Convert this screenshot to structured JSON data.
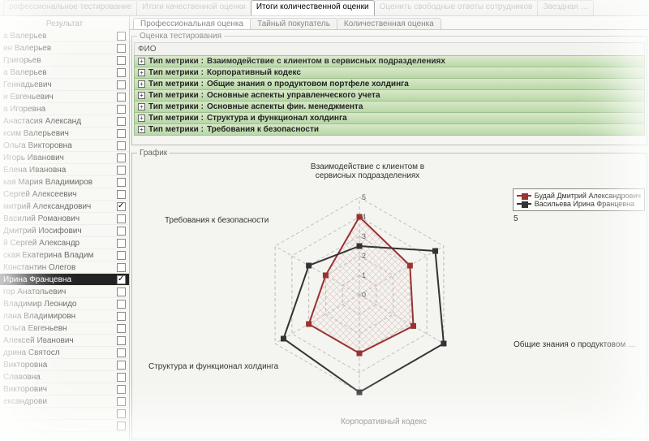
{
  "mainTabs": [
    {
      "label": "рофессиональное тестирование",
      "active": false
    },
    {
      "label": "Итоги качественной оценки",
      "active": false
    },
    {
      "label": "Итоги количественной оценки",
      "active": true
    },
    {
      "label": "Оценить свободные ответы сотрудников",
      "active": false
    },
    {
      "label": "Звездная …",
      "active": false
    }
  ],
  "sidebar": {
    "header": "Результат",
    "items": [
      {
        "label": "а Валерьев",
        "checked": false
      },
      {
        "label": "ин Валерьев",
        "checked": false
      },
      {
        "label": "Григорьев",
        "checked": false
      },
      {
        "label": "а Валерьев",
        "checked": false
      },
      {
        "label": "Геннадьевич",
        "checked": false
      },
      {
        "label": "и Евгеньевич",
        "checked": false
      },
      {
        "label": "а Игоревна",
        "checked": false
      },
      {
        "label": "Анастасия Александ",
        "checked": false
      },
      {
        "label": "ксим Валерьевич",
        "checked": false
      },
      {
        "label": "Ольга Викторовна",
        "checked": false
      },
      {
        "label": "Игорь Иванович",
        "checked": false
      },
      {
        "label": "Елена Ивановна",
        "checked": false
      },
      {
        "label": "кая Мария Владимиров",
        "checked": false
      },
      {
        "label": "Сергей Алексеевич",
        "checked": false
      },
      {
        "label": "митрий Александрович",
        "checked": true
      },
      {
        "label": "Василий Романович",
        "checked": false
      },
      {
        "label": "Дмитрий Иосифович",
        "checked": false
      },
      {
        "label": "й Сергей Александр",
        "checked": false
      },
      {
        "label": "ская Екатерина Владим",
        "checked": false
      },
      {
        "label": "Константин Олегов",
        "checked": false
      },
      {
        "label": "Ирина Францевна",
        "checked": true,
        "selected": true
      },
      {
        "label": "гор Анатольевич",
        "checked": false
      },
      {
        "label": "Владимир Леонидо",
        "checked": false
      },
      {
        "label": "лана Владимировн",
        "checked": false
      },
      {
        "label": "Ольга Евгеньевн",
        "checked": false
      },
      {
        "label": "Алексей Иванович",
        "checked": false
      },
      {
        "label": "дрина Святосл",
        "checked": false
      },
      {
        "label": "Викторовна",
        "checked": false
      },
      {
        "label": "Славовна",
        "checked": false
      },
      {
        "label": "Викторович",
        "checked": false
      },
      {
        "label": "ександрови",
        "checked": false
      },
      {
        "label": "",
        "checked": false
      },
      {
        "label": "",
        "checked": false
      }
    ]
  },
  "subTabs": [
    {
      "label": "Профессиональная оценка",
      "active": true
    },
    {
      "label": "Тайный покупатель",
      "active": false
    },
    {
      "label": "Количественная оценка",
      "active": false
    }
  ],
  "testingLegend": "Оценка тестирования",
  "gridHeader": "ФИО",
  "metricPrefix": "Тип метрики : ",
  "metrics": [
    "Взаимодействие с клиентом в сервисных подразделениях",
    "Корпоративный кодекс",
    "Общие знания о продуктовом портфеле холдинга",
    "Основные аспекты управленческого учета",
    "Основные аспекты фин. менеджмента",
    "Структура и функционал холдинга",
    "Требования к безопасности"
  ],
  "chartLegend": "График",
  "legendEntries": [
    {
      "label": "Будай Дмитрий Александрович",
      "color": "#993333"
    },
    {
      "label": "Васильева Ирина Францевна",
      "color": "#333333"
    }
  ],
  "chart_data": {
    "type": "radar",
    "axisMax": 5,
    "categories": [
      "Взаимодействие с клиентом в сервисных подразделениях",
      "5",
      "Общие знания о продуктовом …",
      "Корпоративный кодекс",
      "Структура и функционал холдинга",
      "Требования к безопасности"
    ],
    "ticks": [
      0,
      1,
      2,
      3,
      4,
      5
    ],
    "series": [
      {
        "name": "Будай Дмитрий Александрович",
        "color": "#993333",
        "values": [
          4.0,
          3.0,
          3.2,
          3.0,
          3.0,
          2.0
        ]
      },
      {
        "name": "Васильева Ирина Францевна",
        "color": "#333333",
        "values": [
          2.5,
          4.5,
          5.0,
          5.0,
          4.5,
          3.0
        ]
      }
    ]
  }
}
